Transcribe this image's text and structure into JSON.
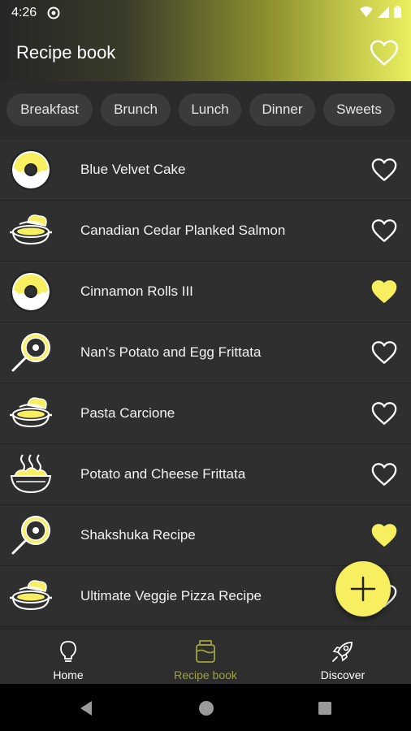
{
  "status": {
    "time": "4:26"
  },
  "appbar": {
    "title": "Recipe book",
    "favorite_icon": "heart-outline-icon"
  },
  "chips": [
    "Breakfast",
    "Brunch",
    "Lunch",
    "Dinner",
    "Sweets"
  ],
  "recipes": [
    {
      "name": "Blue Velvet Cake",
      "icon": "donut-icon",
      "favorite": false
    },
    {
      "name": "Canadian Cedar Planked Salmon",
      "icon": "casserole-icon",
      "favorite": false
    },
    {
      "name": "Cinnamon Rolls III",
      "icon": "donut-icon",
      "favorite": true
    },
    {
      "name": "Nan's Potato and Egg Frittata",
      "icon": "frying-pan-egg-icon",
      "favorite": false
    },
    {
      "name": "Pasta Carcione",
      "icon": "casserole-icon",
      "favorite": false
    },
    {
      "name": "Potato and Cheese Frittata",
      "icon": "hot-bowl-icon",
      "favorite": false
    },
    {
      "name": "Shakshuka Recipe",
      "icon": "frying-pan-egg-icon",
      "favorite": true
    },
    {
      "name": "Ultimate Veggie Pizza Recipe",
      "icon": "casserole-icon",
      "favorite": false
    }
  ],
  "fab": {
    "icon": "plus-icon"
  },
  "bottom_nav": [
    {
      "label": "Home",
      "icon": "lightbulb-icon",
      "active": false
    },
    {
      "label": "Recipe book",
      "icon": "recipe-jar-icon",
      "active": true
    },
    {
      "label": "Discover",
      "icon": "rocket-icon",
      "active": false
    }
  ],
  "colors": {
    "accent": "#f7ef5f",
    "active_nav": "#9da13a",
    "background": "#2b2b2b"
  }
}
